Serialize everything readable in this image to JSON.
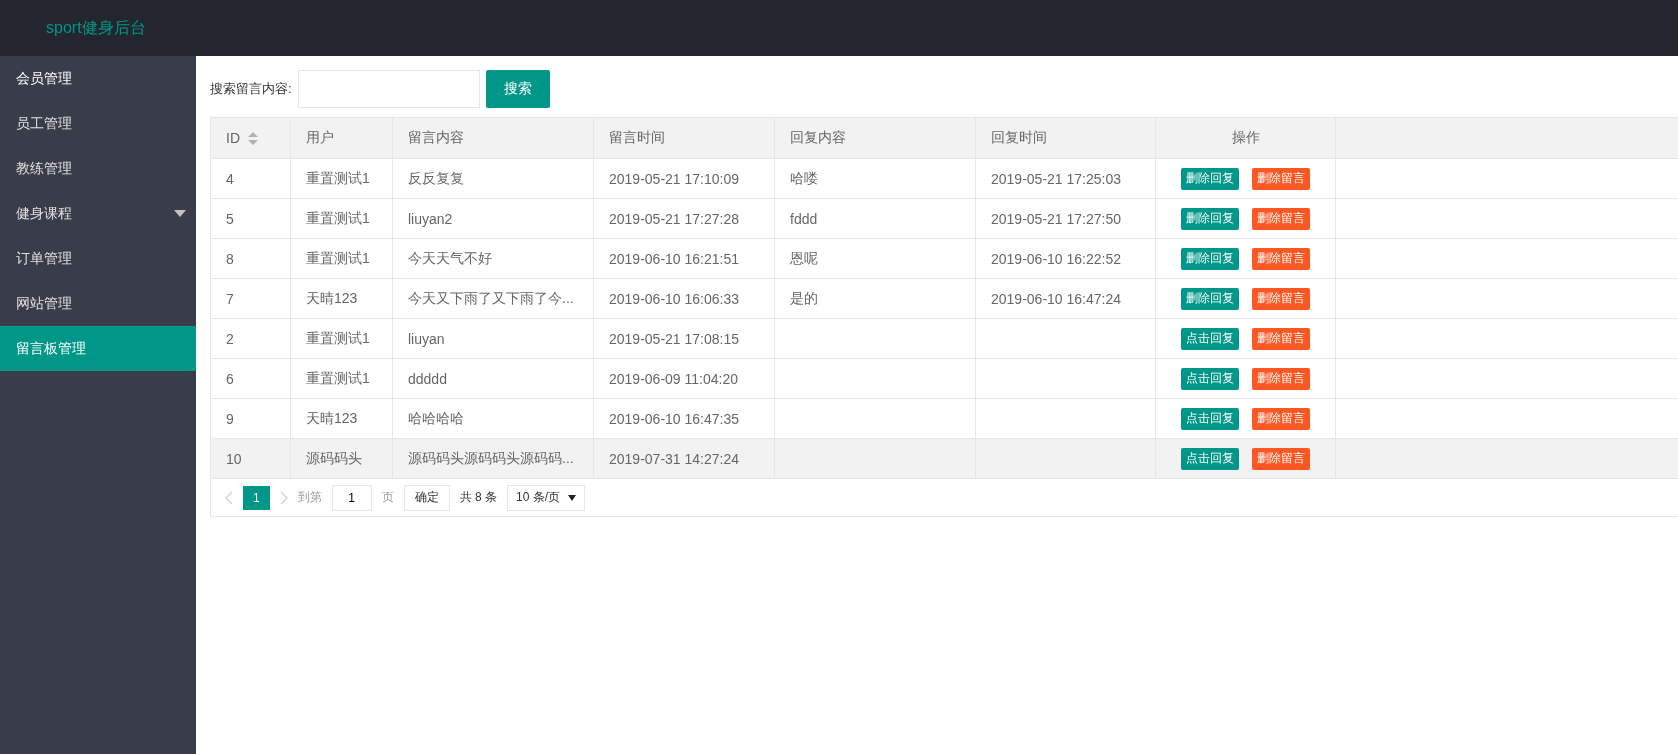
{
  "header": {
    "title": "sport健身后台"
  },
  "sidebar": {
    "items": [
      {
        "label": "会员管理",
        "kind": "link",
        "selected": false
      },
      {
        "label": "员工管理",
        "kind": "link",
        "selected": false
      },
      {
        "label": "教练管理",
        "kind": "link",
        "selected": false
      },
      {
        "label": "健身课程",
        "kind": "group",
        "selected": false
      },
      {
        "label": "订单管理",
        "kind": "link",
        "selected": false
      },
      {
        "label": "网站管理",
        "kind": "link",
        "selected": false
      },
      {
        "label": "留言板管理",
        "kind": "link",
        "selected": true
      }
    ]
  },
  "search": {
    "label": "搜索留言内容:",
    "button": "搜索"
  },
  "table": {
    "columns": [
      {
        "label": "ID",
        "sortable": true
      },
      {
        "label": "用户",
        "sortable": false
      },
      {
        "label": "留言内容",
        "sortable": false
      },
      {
        "label": "留言时间",
        "sortable": false
      },
      {
        "label": "回复内容",
        "sortable": false
      },
      {
        "label": "回复时间",
        "sortable": false
      },
      {
        "label": "操作",
        "sortable": false
      }
    ],
    "rows": [
      {
        "cells": [
          "4",
          "重置测试1",
          "反反复复",
          "2019-05-21 17:10:09",
          "哈喽",
          "2019-05-21 17:25:03"
        ],
        "highlighted": false,
        "actions": [
          {
            "label": "删除回复",
            "kind": "reply"
          },
          {
            "label": "删除留言",
            "kind": "delete"
          }
        ]
      },
      {
        "cells": [
          "5",
          "重置测试1",
          "liuyan2",
          "2019-05-21 17:27:28",
          "fddd",
          "2019-05-21 17:27:50"
        ],
        "highlighted": false,
        "actions": [
          {
            "label": "删除回复",
            "kind": "reply"
          },
          {
            "label": "删除留言",
            "kind": "delete"
          }
        ]
      },
      {
        "cells": [
          "8",
          "重置测试1",
          "今天天气不好",
          "2019-06-10 16:21:51",
          "恩呢",
          "2019-06-10 16:22:52"
        ],
        "highlighted": false,
        "actions": [
          {
            "label": "删除回复",
            "kind": "reply"
          },
          {
            "label": "删除留言",
            "kind": "delete"
          }
        ]
      },
      {
        "cells": [
          "7",
          "天晴123",
          "今天又下雨了又下雨了今...",
          "2019-06-10 16:06:33",
          "是的",
          "2019-06-10 16:47:24"
        ],
        "highlighted": false,
        "actions": [
          {
            "label": "删除回复",
            "kind": "reply"
          },
          {
            "label": "删除留言",
            "kind": "delete"
          }
        ]
      },
      {
        "cells": [
          "2",
          "重置测试1",
          "liuyan",
          "2019-05-21 17:08:15",
          "",
          ""
        ],
        "highlighted": false,
        "actions": [
          {
            "label": "点击回复",
            "kind": "reply"
          },
          {
            "label": "删除留言",
            "kind": "delete"
          }
        ]
      },
      {
        "cells": [
          "6",
          "重置测试1",
          "ddddd",
          "2019-06-09 11:04:20",
          "",
          ""
        ],
        "highlighted": false,
        "actions": [
          {
            "label": "点击回复",
            "kind": "reply"
          },
          {
            "label": "删除留言",
            "kind": "delete"
          }
        ]
      },
      {
        "cells": [
          "9",
          "天晴123",
          "哈哈哈哈",
          "2019-06-10 16:47:35",
          "",
          ""
        ],
        "highlighted": false,
        "actions": [
          {
            "label": "点击回复",
            "kind": "reply"
          },
          {
            "label": "删除留言",
            "kind": "delete"
          }
        ]
      },
      {
        "cells": [
          "10",
          "源码码头",
          "源码码头源码码头源码码...",
          "2019-07-31 14:27:24",
          "",
          ""
        ],
        "highlighted": true,
        "actions": [
          {
            "label": "点击回复",
            "kind": "reply"
          },
          {
            "label": "删除留言",
            "kind": "delete"
          }
        ]
      }
    ]
  },
  "pagination": {
    "prev": {
      "disabled": true
    },
    "pages": [
      {
        "label": "1",
        "selected": true
      }
    ],
    "next": {
      "disabled": true
    },
    "goto_label": "到第",
    "goto_value": "1",
    "page_unit": "页",
    "confirm": "确定",
    "total": "共 8 条",
    "page_size": "10 条/页"
  }
}
